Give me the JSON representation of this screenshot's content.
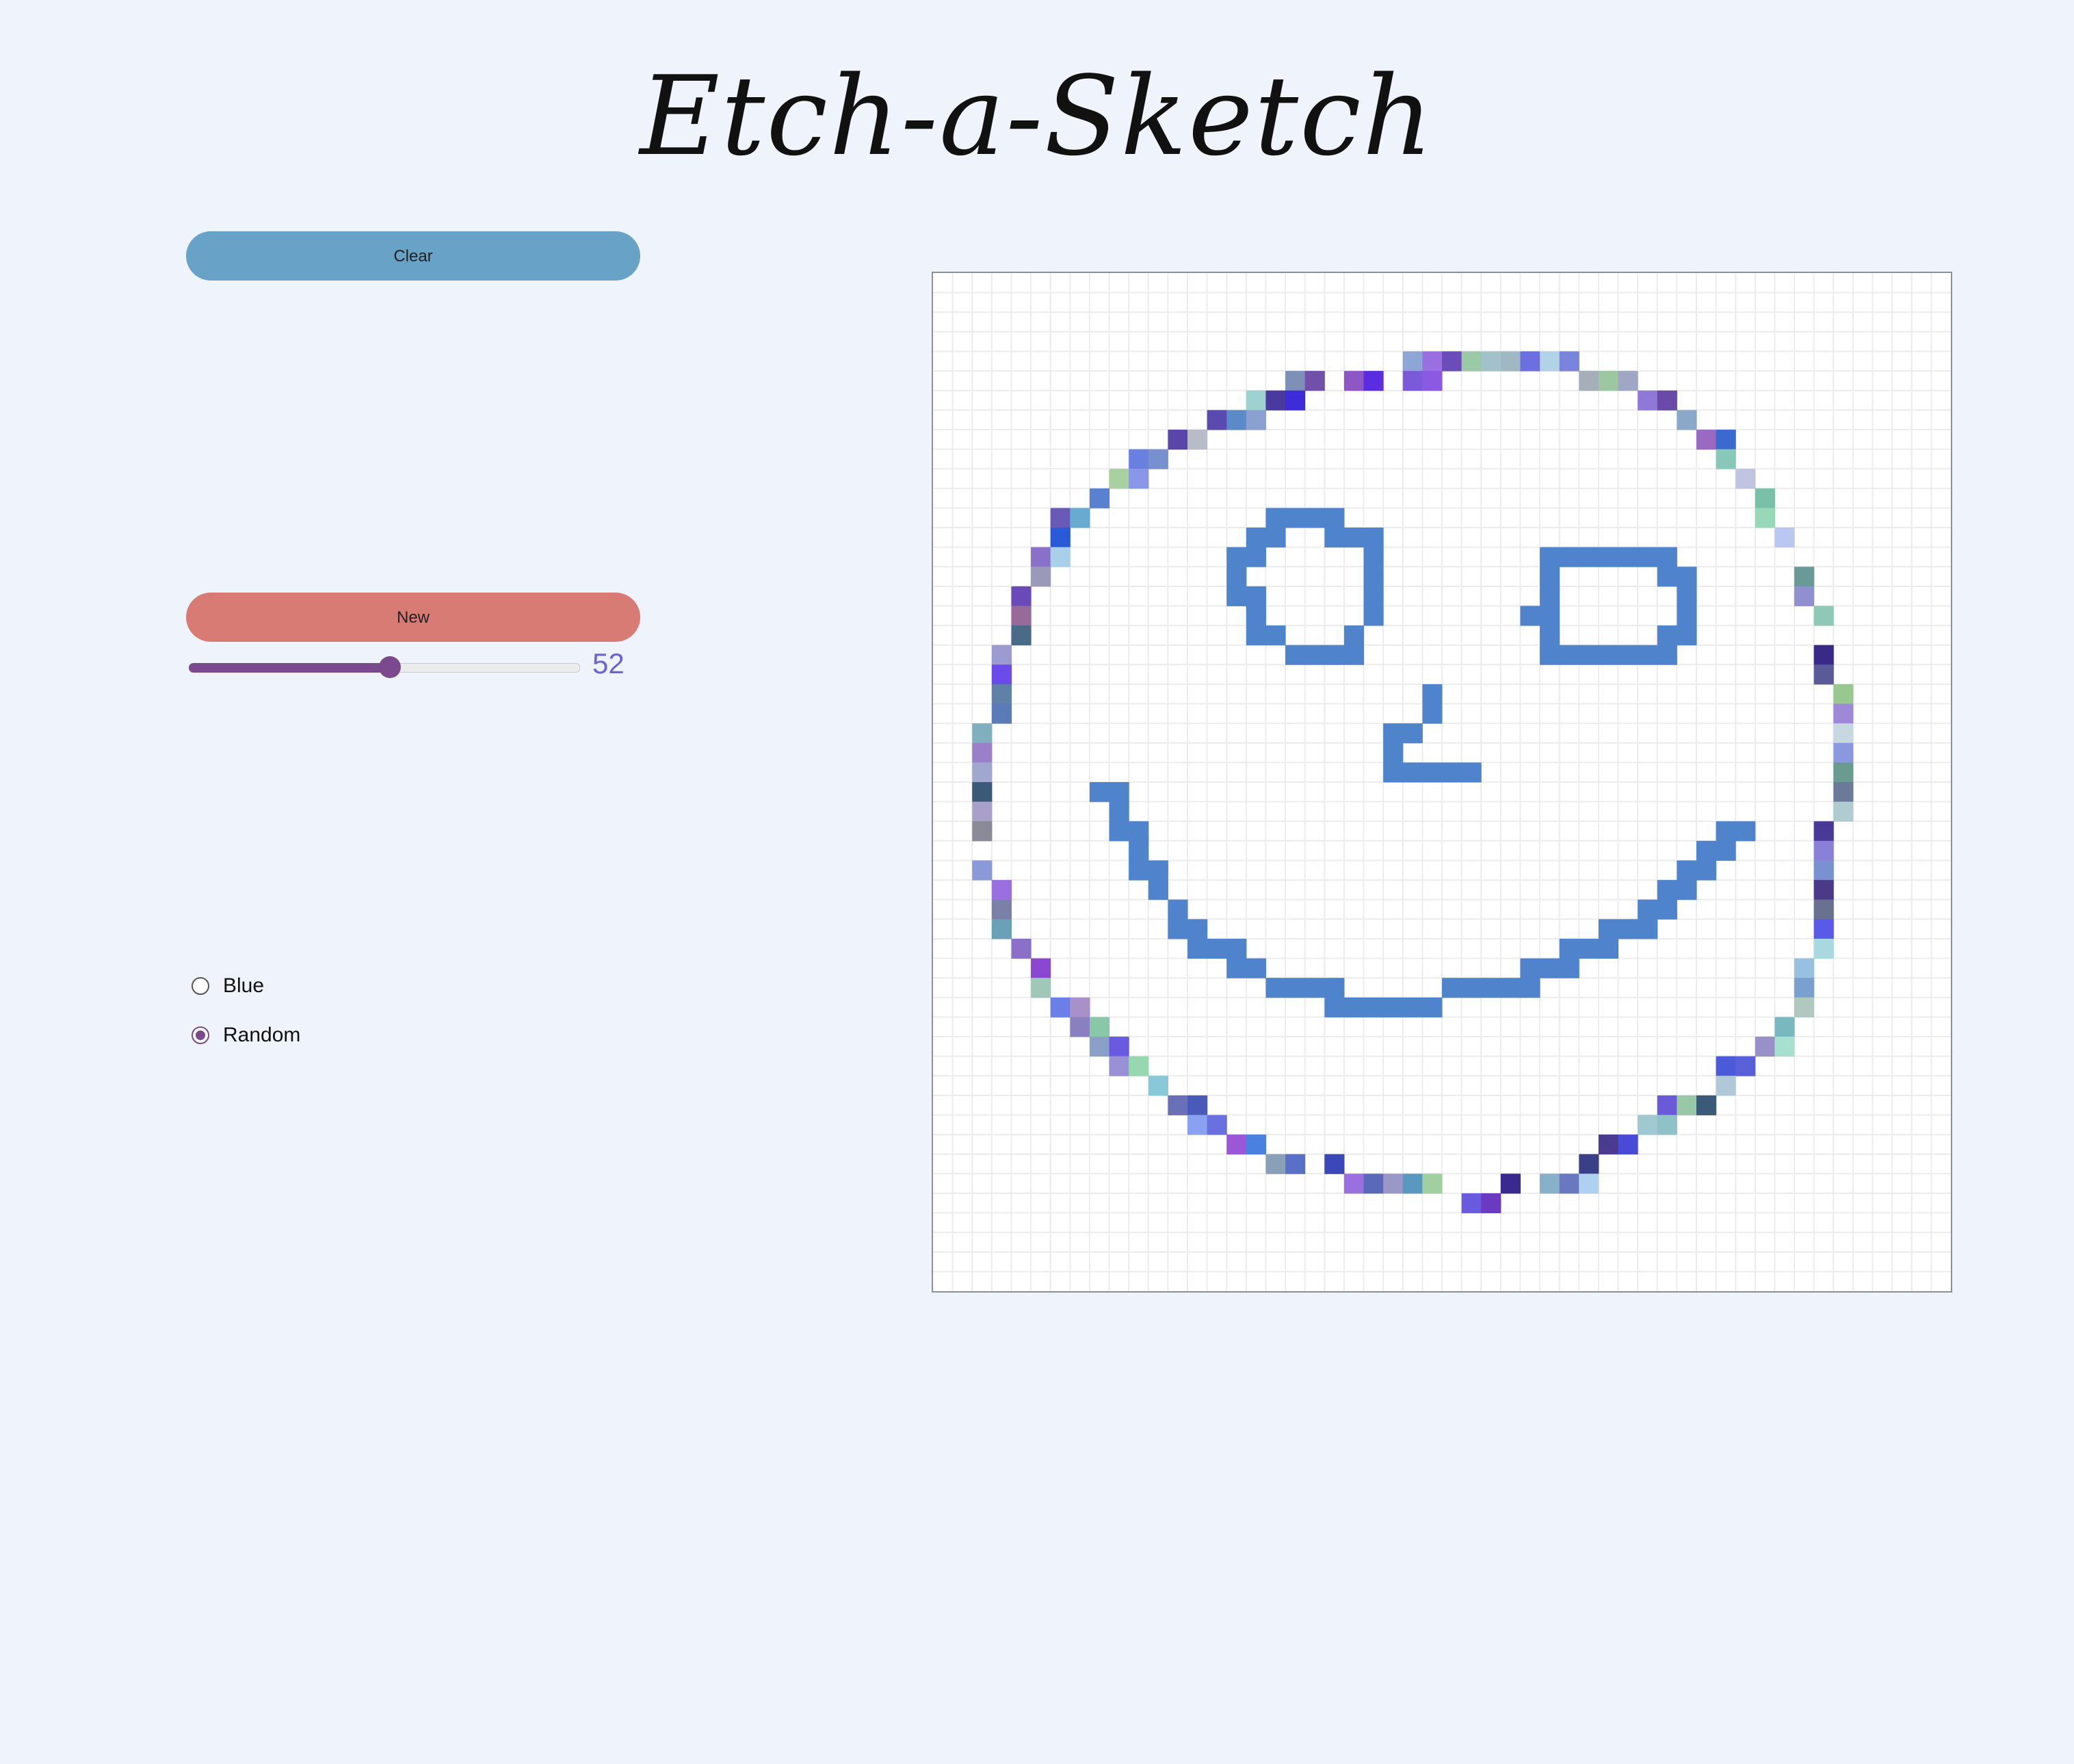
{
  "app": {
    "title": "Etch-a-Sketch"
  },
  "controls": {
    "clear_label": "Clear",
    "new_label": "New",
    "grid_size": 52,
    "grid_size_min": 1,
    "grid_size_max": 100,
    "color_modes": [
      {
        "label": "Blue",
        "checked": false
      },
      {
        "label": "Random",
        "checked": true
      }
    ]
  },
  "colors": {
    "background": "#eff3fc",
    "clear_button": "#68a2c6",
    "new_button": "#d87b75",
    "accent": "#7b4a8e",
    "slider_value": "#6b63d8",
    "blue_ink": "#4f84cc"
  },
  "sketch": {
    "blue_cells": [
      [
        17,
        12
      ],
      [
        18,
        12
      ],
      [
        19,
        12
      ],
      [
        20,
        12
      ],
      [
        16,
        13
      ],
      [
        17,
        13
      ],
      [
        20,
        13
      ],
      [
        21,
        13
      ],
      [
        22,
        13
      ],
      [
        15,
        14
      ],
      [
        16,
        14
      ],
      [
        22,
        14
      ],
      [
        15,
        15
      ],
      [
        22,
        15
      ],
      [
        31,
        14
      ],
      [
        32,
        14
      ],
      [
        33,
        14
      ],
      [
        34,
        14
      ],
      [
        35,
        14
      ],
      [
        36,
        14
      ],
      [
        37,
        14
      ],
      [
        15,
        16
      ],
      [
        16,
        16
      ],
      [
        22,
        16
      ],
      [
        31,
        15
      ],
      [
        37,
        15
      ],
      [
        38,
        15
      ],
      [
        16,
        17
      ],
      [
        22,
        17
      ],
      [
        31,
        16
      ],
      [
        38,
        16
      ],
      [
        16,
        18
      ],
      [
        17,
        18
      ],
      [
        21,
        18
      ],
      [
        31,
        17
      ],
      [
        38,
        17
      ],
      [
        30,
        17
      ],
      [
        18,
        19
      ],
      [
        19,
        19
      ],
      [
        20,
        19
      ],
      [
        21,
        19
      ],
      [
        31,
        18
      ],
      [
        37,
        18
      ],
      [
        38,
        18
      ],
      [
        31,
        19
      ],
      [
        32,
        19
      ],
      [
        33,
        19
      ],
      [
        34,
        19
      ],
      [
        35,
        19
      ],
      [
        36,
        19
      ],
      [
        37,
        19
      ],
      [
        25,
        21
      ],
      [
        25,
        22
      ],
      [
        23,
        23
      ],
      [
        24,
        23
      ],
      [
        23,
        24
      ],
      [
        23,
        25
      ],
      [
        24,
        25
      ],
      [
        25,
        25
      ],
      [
        26,
        25
      ],
      [
        27,
        25
      ],
      [
        8,
        26
      ],
      [
        9,
        26
      ],
      [
        9,
        27
      ],
      [
        9,
        28
      ],
      [
        10,
        28
      ],
      [
        10,
        29
      ],
      [
        10,
        30
      ],
      [
        11,
        30
      ],
      [
        11,
        31
      ],
      [
        12,
        32
      ],
      [
        12,
        33
      ],
      [
        13,
        33
      ],
      [
        13,
        34
      ],
      [
        14,
        34
      ],
      [
        15,
        34
      ],
      [
        15,
        35
      ],
      [
        16,
        35
      ],
      [
        17,
        36
      ],
      [
        18,
        36
      ],
      [
        19,
        36
      ],
      [
        20,
        36
      ],
      [
        20,
        37
      ],
      [
        21,
        37
      ],
      [
        22,
        37
      ],
      [
        23,
        37
      ],
      [
        24,
        37
      ],
      [
        25,
        37
      ],
      [
        26,
        36
      ],
      [
        27,
        36
      ],
      [
        28,
        36
      ],
      [
        29,
        36
      ],
      [
        30,
        36
      ],
      [
        30,
        35
      ],
      [
        31,
        35
      ],
      [
        32,
        35
      ],
      [
        32,
        34
      ],
      [
        33,
        34
      ],
      [
        34,
        34
      ],
      [
        34,
        33
      ],
      [
        35,
        33
      ],
      [
        36,
        33
      ],
      [
        36,
        32
      ],
      [
        37,
        32
      ],
      [
        37,
        31
      ],
      [
        38,
        31
      ],
      [
        38,
        30
      ],
      [
        39,
        30
      ],
      [
        39,
        29
      ],
      [
        40,
        29
      ],
      [
        40,
        28
      ],
      [
        41,
        28
      ]
    ],
    "random_cells": [
      [
        24,
        4,
        "#8ea6d6"
      ],
      [
        25,
        4,
        "#9a6fe0"
      ],
      [
        26,
        4,
        "#6a4db8"
      ],
      [
        27,
        4,
        "#9ac9a8"
      ],
      [
        28,
        4,
        "#a2c1c8"
      ],
      [
        29,
        4,
        "#9fb8c2"
      ],
      [
        30,
        4,
        "#6b6fe0"
      ],
      [
        31,
        4,
        "#b2d2e8"
      ],
      [
        32,
        4,
        "#7a84dc"
      ],
      [
        18,
        5,
        "#7e90b8"
      ],
      [
        19,
        5,
        "#7050a8"
      ],
      [
        21,
        5,
        "#8d58c6"
      ],
      [
        22,
        5,
        "#5a2ee0"
      ],
      [
        24,
        5,
        "#7a5ad8"
      ],
      [
        25,
        5,
        "#8b5ae2"
      ],
      [
        33,
        5,
        "#a6aeba"
      ],
      [
        34,
        5,
        "#9cc7a0"
      ],
      [
        35,
        5,
        "#a0a7c4"
      ],
      [
        16,
        6,
        "#9ed2d0"
      ],
      [
        17,
        6,
        "#4a3aa0"
      ],
      [
        18,
        6,
        "#3d2cd8"
      ],
      [
        36,
        6,
        "#9078d8"
      ],
      [
        37,
        6,
        "#6a4aa8"
      ],
      [
        14,
        7,
        "#5a4ab0"
      ],
      [
        15,
        7,
        "#5a8ac8"
      ],
      [
        16,
        7,
        "#8aa0d0"
      ],
      [
        38,
        7,
        "#8aa8c8"
      ],
      [
        12,
        8,
        "#5a46a8"
      ],
      [
        13,
        8,
        "#b8bcc8"
      ],
      [
        39,
        8,
        "#9a6ac0"
      ],
      [
        40,
        8,
        "#3a6ad0"
      ],
      [
        10,
        9,
        "#6a80e0"
      ],
      [
        11,
        9,
        "#7890d0"
      ],
      [
        40,
        9,
        "#88c8b8"
      ],
      [
        9,
        10,
        "#a8d0a0"
      ],
      [
        10,
        10,
        "#8a96e8"
      ],
      [
        41,
        10,
        "#c0c4e0"
      ],
      [
        8,
        11,
        "#5a80d0"
      ],
      [
        42,
        11,
        "#7ac0a8"
      ],
      [
        6,
        12,
        "#6a5ab8"
      ],
      [
        7,
        12,
        "#68aad0"
      ],
      [
        42,
        12,
        "#98d8b8"
      ],
      [
        6,
        13,
        "#2a5ad8"
      ],
      [
        43,
        13,
        "#b8c8f0"
      ],
      [
        5,
        14,
        "#8a70c8"
      ],
      [
        6,
        14,
        "#a8d0e8"
      ],
      [
        5,
        15,
        "#9a9ab8"
      ],
      [
        44,
        15,
        "#6a9a98"
      ],
      [
        4,
        16,
        "#6a4ab8"
      ],
      [
        44,
        16,
        "#9090d0"
      ],
      [
        4,
        17,
        "#986a9a"
      ],
      [
        45,
        17,
        "#90c8b8"
      ],
      [
        4,
        18,
        "#4a6a88"
      ],
      [
        3,
        19,
        "#9c9ad0"
      ],
      [
        45,
        19,
        "#3a2a88"
      ],
      [
        3,
        20,
        "#6a4ae8"
      ],
      [
        45,
        20,
        "#5a5a98"
      ],
      [
        3,
        21,
        "#6080a8"
      ],
      [
        46,
        21,
        "#98c890"
      ],
      [
        3,
        22,
        "#5a7ab8"
      ],
      [
        46,
        22,
        "#a088d8"
      ],
      [
        2,
        23,
        "#80b0c0"
      ],
      [
        46,
        23,
        "#c8d8e0"
      ],
      [
        2,
        24,
        "#9a80c8"
      ],
      [
        46,
        24,
        "#8a98e0"
      ],
      [
        2,
        25,
        "#a0a8d0"
      ],
      [
        46,
        25,
        "#6a9a90"
      ],
      [
        2,
        26,
        "#3a5a78"
      ],
      [
        46,
        26,
        "#6a7a98"
      ],
      [
        2,
        27,
        "#a8a0c8"
      ],
      [
        46,
        27,
        "#b0ccd0"
      ],
      [
        2,
        28,
        "#8a8a98"
      ],
      [
        45,
        28,
        "#4a3a98"
      ],
      [
        45,
        29,
        "#8a80d8"
      ],
      [
        2,
        30,
        "#8a9ad8"
      ],
      [
        45,
        30,
        "#7a90d0"
      ],
      [
        3,
        31,
        "#9a70e0"
      ],
      [
        45,
        31,
        "#4a3a88"
      ],
      [
        3,
        32,
        "#7a80a8"
      ],
      [
        45,
        32,
        "#6a7090"
      ],
      [
        3,
        33,
        "#6aa0b8"
      ],
      [
        45,
        33,
        "#5a5ae8"
      ],
      [
        4,
        34,
        "#8a70c8"
      ],
      [
        45,
        34,
        "#a8d8e0"
      ],
      [
        5,
        35,
        "#8a48d0"
      ],
      [
        44,
        35,
        "#98c0e0"
      ],
      [
        5,
        36,
        "#a0c8b8"
      ],
      [
        44,
        36,
        "#7aa0d0"
      ],
      [
        6,
        37,
        "#6a80e8"
      ],
      [
        7,
        37,
        "#a890c8"
      ],
      [
        44,
        37,
        "#b0c8c0"
      ],
      [
        7,
        38,
        "#8a80c0"
      ],
      [
        8,
        38,
        "#88c8a8"
      ],
      [
        43,
        38,
        "#7ab8c0"
      ],
      [
        8,
        39,
        "#8aa0c8"
      ],
      [
        9,
        39,
        "#6a5ae0"
      ],
      [
        42,
        39,
        "#9a90c8"
      ],
      [
        43,
        39,
        "#a8e0d0"
      ],
      [
        9,
        40,
        "#9a90d8"
      ],
      [
        10,
        40,
        "#98d8b0"
      ],
      [
        40,
        40,
        "#4a5ad8"
      ],
      [
        41,
        40,
        "#5a60d8"
      ],
      [
        11,
        41,
        "#88c8d8"
      ],
      [
        40,
        41,
        "#b0c8d8"
      ],
      [
        12,
        42,
        "#6a70b8"
      ],
      [
        13,
        42,
        "#4a5ab8"
      ],
      [
        37,
        42,
        "#6a5ad8"
      ],
      [
        38,
        42,
        "#98c8a8"
      ],
      [
        39,
        42,
        "#3a5a78"
      ],
      [
        13,
        43,
        "#8aa0f0"
      ],
      [
        14,
        43,
        "#6a70e0"
      ],
      [
        36,
        43,
        "#a0c8d0"
      ],
      [
        37,
        43,
        "#90c0c8"
      ],
      [
        15,
        44,
        "#9a58d8"
      ],
      [
        16,
        44,
        "#4a80e0"
      ],
      [
        34,
        44,
        "#4a3a90"
      ],
      [
        35,
        44,
        "#4a4ad8"
      ],
      [
        17,
        45,
        "#8aa0b8"
      ],
      [
        18,
        45,
        "#5a70c8"
      ],
      [
        20,
        45,
        "#3a48b8"
      ],
      [
        33,
        45,
        "#3a4088"
      ],
      [
        21,
        46,
        "#9a70e0"
      ],
      [
        22,
        46,
        "#5a6ab8"
      ],
      [
        23,
        46,
        "#9a98c8"
      ],
      [
        24,
        46,
        "#5a98c0"
      ],
      [
        25,
        46,
        "#a0d0a0"
      ],
      [
        29,
        46,
        "#3a2a90"
      ],
      [
        31,
        46,
        "#88b0c8"
      ],
      [
        32,
        46,
        "#6a78c0"
      ],
      [
        33,
        46,
        "#b0d0f0"
      ],
      [
        27,
        47,
        "#6a5ae0"
      ],
      [
        28,
        47,
        "#6a3ac0"
      ]
    ]
  }
}
